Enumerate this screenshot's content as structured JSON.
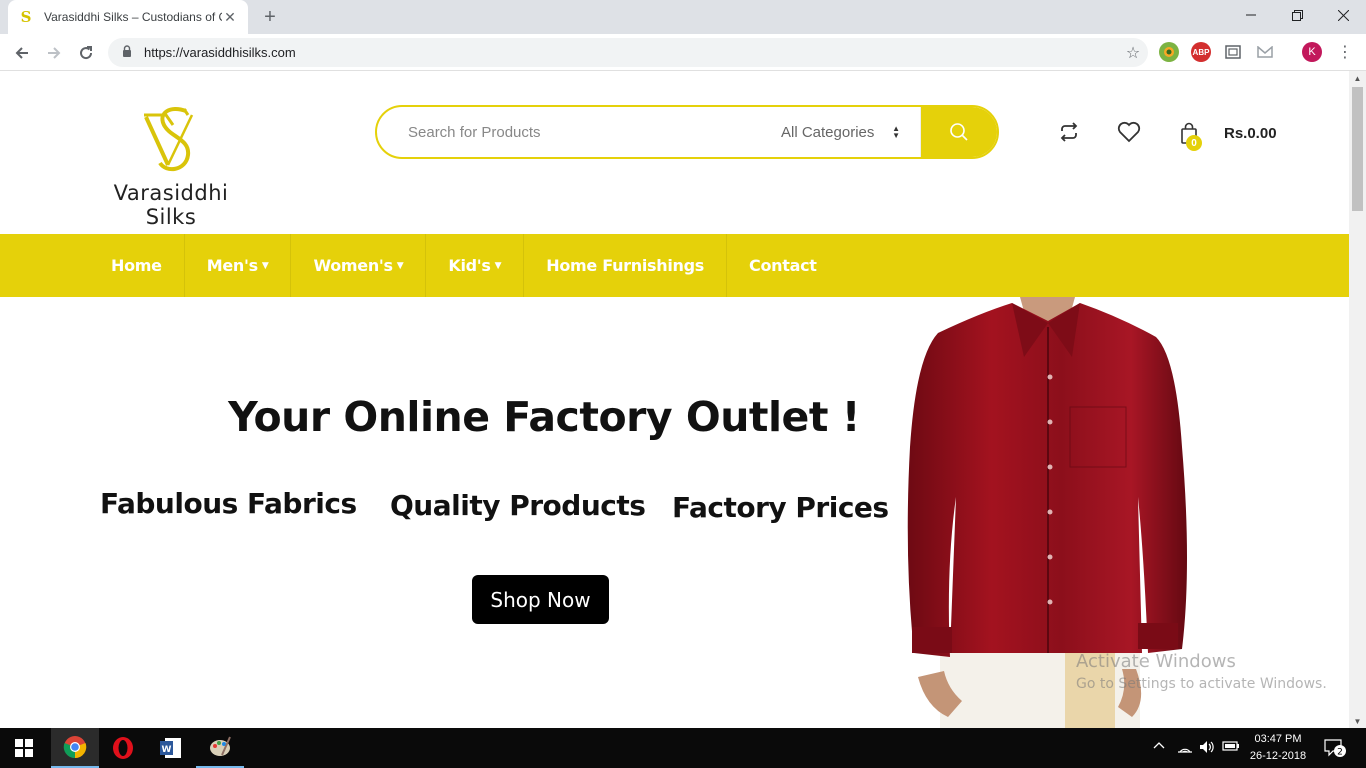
{
  "browser": {
    "tab_title": "Varasiddhi Silks – Custodians of C",
    "tab_close": "✕",
    "new_tab": "+",
    "url": "https://varasiddhisilks.com",
    "profile_initial": "K",
    "extensions": [
      "earth-extension-icon",
      "adblock-plus-icon",
      "screenshot-icon",
      "gmail-icon"
    ],
    "abp_label": "ABP"
  },
  "site": {
    "brand_name": "Varasiddhi Silks",
    "accent_color": "#e5d10a",
    "search": {
      "placeholder": "Search for Products",
      "category": "All Categories"
    },
    "cart": {
      "count": "0",
      "total": "Rs.0.00"
    },
    "nav": [
      {
        "label": "Home",
        "dropdown": false
      },
      {
        "label": "Men's",
        "dropdown": true
      },
      {
        "label": "Women's",
        "dropdown": true
      },
      {
        "label": "Kid's",
        "dropdown": true
      },
      {
        "label": "Home Furnishings",
        "dropdown": false
      },
      {
        "label": "Contact",
        "dropdown": false
      }
    ],
    "hero": {
      "headline": "Your Online Factory Outlet !",
      "taglines": [
        "Fabulous Fabrics",
        "Quality Products",
        "Factory Prices"
      ],
      "cta": "Shop Now"
    }
  },
  "watermark": {
    "line1": "Activate Windows",
    "line2": "Go to Settings to activate Windows."
  },
  "taskbar": {
    "time": "03:47 PM",
    "date": "26-12-2018",
    "notification_count": "2"
  }
}
